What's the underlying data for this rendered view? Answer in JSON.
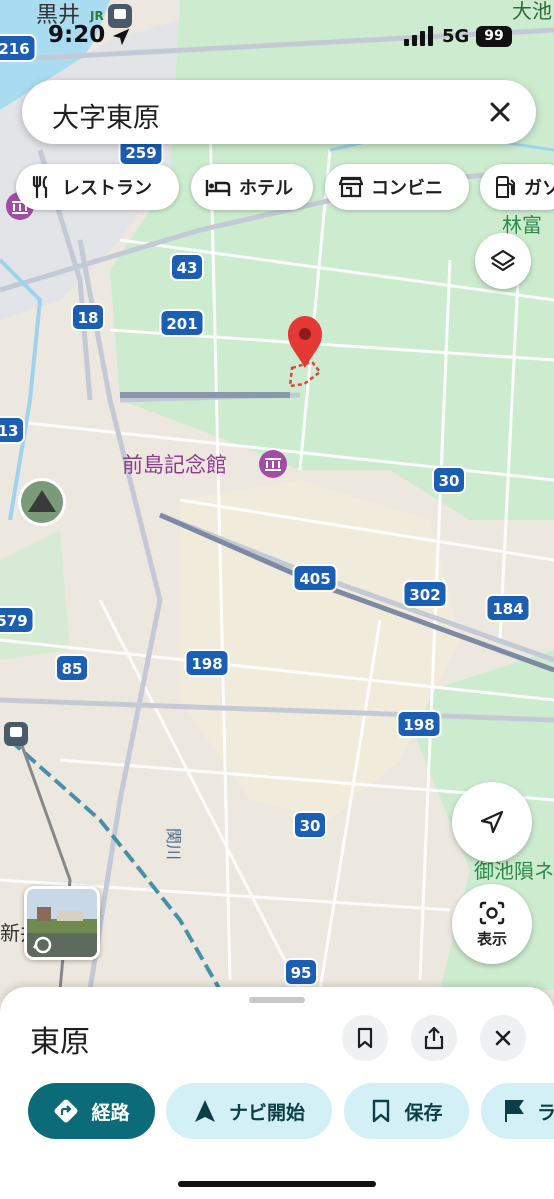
{
  "status_bar": {
    "time": "9:20",
    "network": "5G",
    "battery": "99"
  },
  "search": {
    "query": "大字東原"
  },
  "chips": [
    {
      "label": "レストラン",
      "icon": "restaurant-icon"
    },
    {
      "label": "ホテル",
      "icon": "hotel-icon"
    },
    {
      "label": "コンビニ",
      "icon": "store-icon"
    },
    {
      "label": "ガソ",
      "icon": "gas-station-icon"
    }
  ],
  "map": {
    "labels": {
      "station_top": "黒井",
      "jr": "JR",
      "top_right": "大池",
      "right_area": "林富",
      "museum": "前島記念館",
      "river": "関川",
      "park": "御池隕ネ",
      "bottom_left": "新井"
    },
    "routes": [
      "216",
      "259",
      "43",
      "18",
      "201",
      "13",
      "30",
      "405",
      "302",
      "184",
      "579",
      "85",
      "198",
      "198",
      "30",
      "95"
    ]
  },
  "fab": {
    "display_label": "表示"
  },
  "sheet": {
    "title": "東原",
    "actions": {
      "route": "経路",
      "navigate": "ナビ開始",
      "save": "保存",
      "more": "ラ"
    }
  },
  "colors": {
    "accent": "#0b6b78",
    "accent_light": "#d2f0f5",
    "pin": "#e53935",
    "route_shield": "#1a5fb4",
    "park_green": "#cdeccf"
  }
}
